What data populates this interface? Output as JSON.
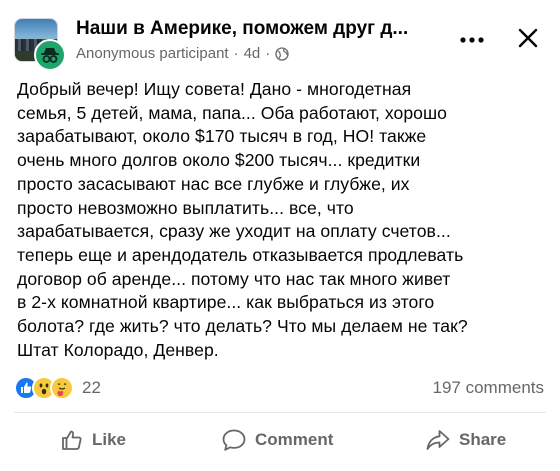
{
  "header": {
    "group_name": "Наши в Америке, поможем друг д...",
    "author": "Anonymous participant",
    "separator": "·",
    "time": "4d",
    "separator2": "·"
  },
  "post": {
    "text": "Добрый вечер! Ищу совета! Дано - многодетная\nсемья, 5 детей, мама, папа... Оба работают, хорошо\nзарабатывают, около $170 тысяч в год, НО! также\nочень много долгов около $200 тысяч... кредитки\nпросто засасывают нас все глубже и глубже, их\nпросто невозможно выплатить... все, что\nзарабатывается, сразу же уходит на оплату счетов...\nтеперь еще и арендодатель отказывается продлевать\nдоговор об аренде... потому что нас так много живет\nв 2-х комнатной квартире... как выбраться из этого\nболота? где жить? что делать? Что мы делаем не так?\nШтат Колорадо, Денвер."
  },
  "stats": {
    "reaction_count": "22",
    "comments": "197 comments",
    "reaction_icons": [
      "like-reaction",
      "wow-reaction",
      "care-reaction"
    ]
  },
  "actions": {
    "like": "Like",
    "comment": "Comment",
    "share": "Share"
  },
  "colors": {
    "secondary_text": "#65676b",
    "like_blue": "#1877f2",
    "anon_green": "#1fa46b"
  }
}
